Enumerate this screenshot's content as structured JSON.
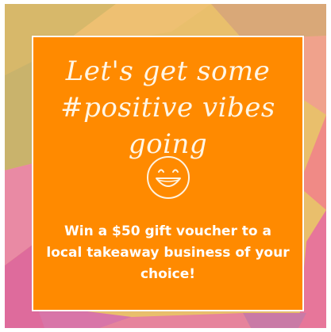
{
  "colors": {
    "card": "#ff8a00",
    "border": "#ffffff",
    "text": "#ffffff",
    "headline_text": "#fff6e6"
  },
  "card": {
    "headline_line1": "Let's get some",
    "headline_line2": "#positive vibes going",
    "message": "Win a $50 gift voucher to a local takeaway business of your choice!"
  },
  "icons": {
    "smiley": "smiley-face-icon"
  }
}
